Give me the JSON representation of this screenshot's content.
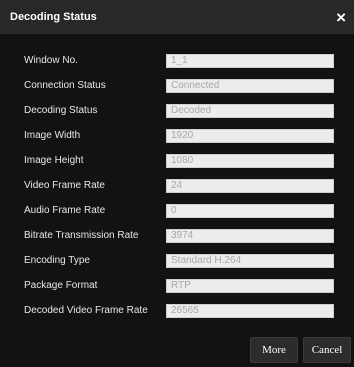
{
  "dialog": {
    "title": "Decoding Status",
    "close_label": "×"
  },
  "fields": [
    {
      "label": "Window No.",
      "value": "1_1"
    },
    {
      "label": "Connection Status",
      "value": "Connected"
    },
    {
      "label": "Decoding Status",
      "value": "Decoded"
    },
    {
      "label": "Image Width",
      "value": "1920"
    },
    {
      "label": "Image Height",
      "value": "1080"
    },
    {
      "label": "Video Frame Rate",
      "value": "24"
    },
    {
      "label": "Audio Frame Rate",
      "value": "0"
    },
    {
      "label": "Bitrate Transmission Rate",
      "value": "3974"
    },
    {
      "label": "Encoding Type",
      "value": "Standard H.264"
    },
    {
      "label": "Package Format",
      "value": "RTP"
    },
    {
      "label": "Decoded Video Frame Rate",
      "value": "26565"
    }
  ],
  "footer": {
    "more_label": "More",
    "cancel_label": "Cancel"
  }
}
